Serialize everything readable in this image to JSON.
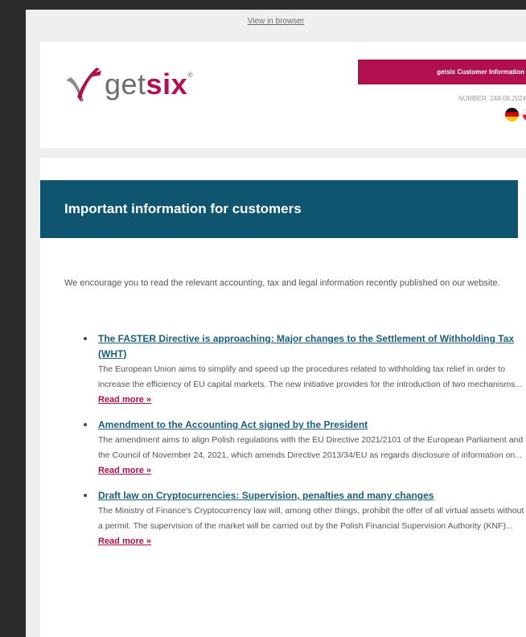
{
  "top": {
    "view_in_browser": "View in browser"
  },
  "header": {
    "logo_get": "get",
    "logo_six": "six",
    "logo_reg": "®",
    "badge": "getsix Customer Information",
    "issue_number": "NUMBER: 248-08.2024",
    "flags": [
      "de-flag",
      "pl-flag"
    ]
  },
  "banner": {
    "title": "Important information for customers"
  },
  "intro": "We encourage you to read the relevant accounting, tax and legal information recently published on our website.",
  "articles": [
    {
      "title": "The FASTER Directive is approaching: Major changes to the Settlement of Withholding Tax (WHT)",
      "description": "The European Union aims to simplify and speed up the procedures related to withholding tax relief in order to increase the efficiency of EU capital markets. The new initiative provides for the introduction of two mechanisms...",
      "read_more": "Read more »"
    },
    {
      "title": "Amendment to the Accounting Act signed by the President",
      "description": "The amendment aims to align Polish regulations with the EU Directive 2021/2101 of the European Parliament and the Council of November 24, 2021, which amends Directive 2013/34/EU as regards disclosure of information on...",
      "read_more": "Read more »"
    },
    {
      "title": "Draft law on Cryptocurrencies: Supervision, penalties and many changes",
      "description": "The Ministry of Finance's Cryptocurrency law will, among other things, prohibit the offer of all virtual assets without a permit. The supervision of the market will be carried out by the Polish Financial Supervision Authority (KNF)...",
      "read_more": "Read more »"
    }
  ],
  "colors": {
    "brand": "#b1104e",
    "banner": "#0f556f",
    "link": "#1c5f7a"
  }
}
